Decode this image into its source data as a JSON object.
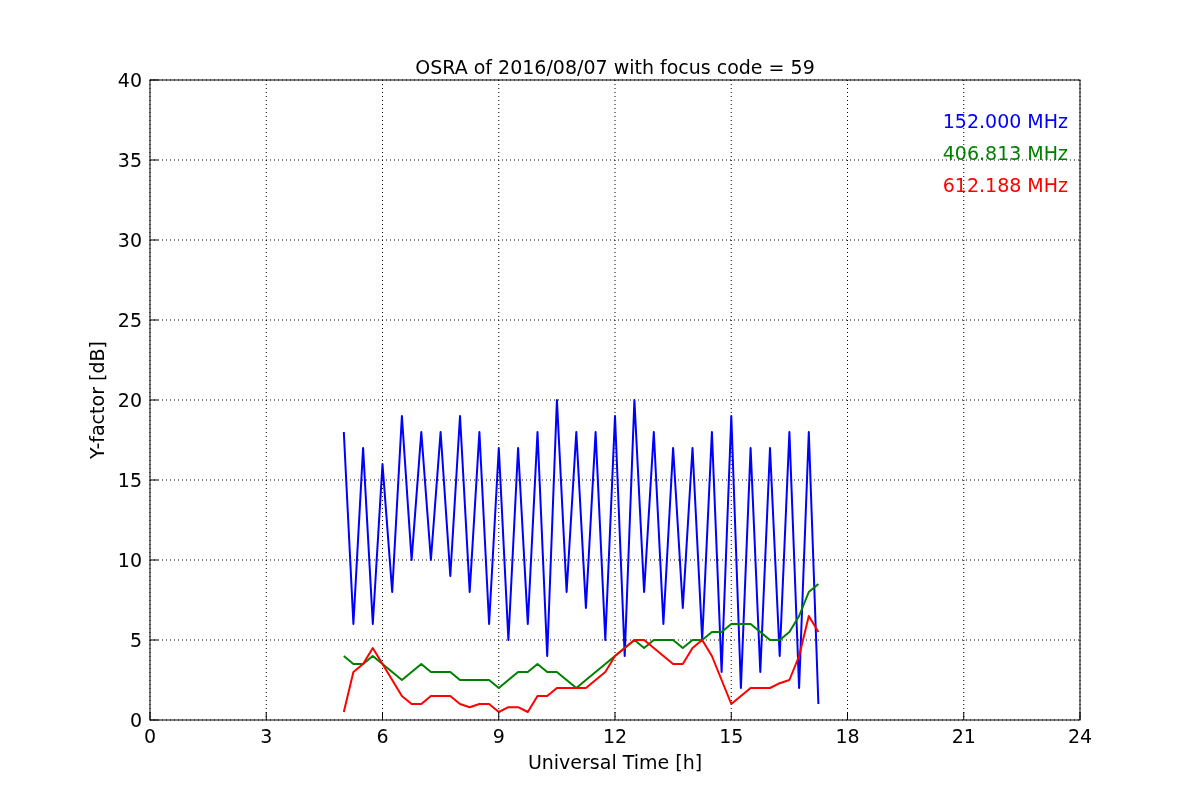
{
  "chart_data": {
    "type": "line",
    "title": "OSRA of 2016/08/07 with focus code = 59",
    "xlabel": "Universal Time [h]",
    "ylabel": "Y-factor [dB]",
    "x": [
      5,
      5.25,
      5.5,
      5.75,
      6,
      6.25,
      6.5,
      6.75,
      7,
      7.25,
      7.5,
      7.75,
      8,
      8.25,
      8.5,
      8.75,
      9,
      9.25,
      9.5,
      9.75,
      10,
      10.25,
      10.5,
      10.75,
      11,
      11.25,
      11.5,
      11.75,
      12,
      12.25,
      12.5,
      12.75,
      13,
      13.25,
      13.5,
      13.75,
      14,
      14.25,
      14.5,
      14.75,
      15,
      15.25,
      15.5,
      15.75,
      16,
      16.25,
      16.5,
      16.75,
      17,
      17.25
    ],
    "series": [
      {
        "name": "152.000 MHz",
        "color": "#0000ff",
        "values": [
          18,
          6,
          17,
          6,
          16,
          8,
          19,
          10,
          18,
          10,
          18,
          9,
          19,
          8,
          18,
          6,
          17,
          5,
          17,
          6,
          18,
          4,
          20,
          8,
          18,
          7,
          18,
          5,
          19,
          4,
          20,
          8,
          18,
          6,
          17,
          7,
          17,
          5,
          18,
          3,
          19,
          2,
          17,
          3,
          17,
          4,
          18,
          2,
          18,
          1
        ]
      },
      {
        "name": "406.813 MHz",
        "color": "#008000",
        "values": [
          4,
          3.5,
          3.5,
          4,
          3.5,
          3,
          2.5,
          3,
          3.5,
          3,
          3,
          3,
          2.5,
          2.5,
          2.5,
          2.5,
          2,
          2.5,
          3,
          3,
          3.5,
          3,
          3,
          2.5,
          2,
          2.5,
          3,
          3.5,
          4,
          4.5,
          5,
          4.5,
          5,
          5,
          5,
          4.5,
          5,
          5,
          5.5,
          5.5,
          6,
          6,
          6,
          5.5,
          5,
          5,
          5.5,
          6.5,
          8,
          8.5
        ]
      },
      {
        "name": "612.188 MHz",
        "color": "#ff0000",
        "values": [
          0.5,
          3,
          3.5,
          4.5,
          3.5,
          2.5,
          1.5,
          1,
          1,
          1.5,
          1.5,
          1.5,
          1,
          0.8,
          1,
          1,
          0.5,
          0.8,
          0.8,
          0.5,
          1.5,
          1.5,
          2,
          2,
          2,
          2,
          2.5,
          3,
          4,
          4.5,
          5,
          5,
          4.5,
          4,
          3.5,
          3.5,
          4.5,
          5,
          4,
          2.5,
          1,
          1.5,
          2,
          2,
          2,
          2.3,
          2.5,
          4,
          6.5,
          5.5
        ]
      }
    ],
    "xlim": [
      0,
      24
    ],
    "ylim": [
      0,
      40
    ],
    "xticks": [
      0,
      3,
      6,
      9,
      12,
      15,
      18,
      21,
      24
    ],
    "yticks": [
      0,
      5,
      10,
      15,
      20,
      25,
      30,
      35,
      40
    ],
    "grid": true
  }
}
